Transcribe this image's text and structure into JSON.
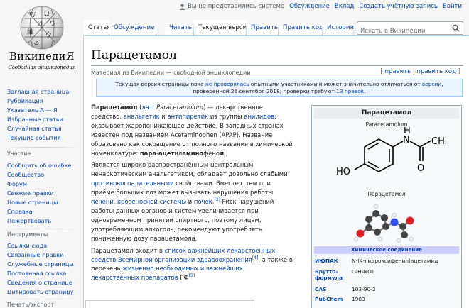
{
  "logo": {
    "name": "ВикипедиЯ",
    "tagline": "Свободная энциклопедия"
  },
  "personal": {
    "not_logged": "Вы не представились системе",
    "links": [
      "Обсуждение",
      "Вклад",
      "Создать учётную запись",
      "Войти"
    ]
  },
  "tabs": {
    "left": [
      {
        "label": "Статья",
        "selected": true
      },
      {
        "label": "Обсуждение",
        "selected": false
      }
    ],
    "right": [
      {
        "label": "Читать",
        "selected": false
      },
      {
        "label": "Текущая версия",
        "selected": true
      },
      {
        "label": "Править",
        "selected": false
      },
      {
        "label": "Править код",
        "selected": false
      },
      {
        "label": "История",
        "selected": false
      }
    ]
  },
  "search": {
    "placeholder": "Искать в Википедии"
  },
  "sidebar": {
    "nav": [
      "Заглавная страница",
      "Рубрикация",
      "Указатель А — Я",
      "Избранные статьи",
      "Случайная статья",
      "Текущие события"
    ],
    "participation_head": "Участие",
    "participation": [
      "Сообщить об ошибке",
      "Сообщество",
      "Форум",
      "Свежие правки",
      "Новые страницы",
      "Справка",
      "Пожертвовать"
    ],
    "tools_head": "Инструменты",
    "tools": [
      "Ссылки сюда",
      "Связанные правки",
      "Служебные страницы",
      "Постоянная ссылка",
      "Сведения о странице",
      "Цитировать страницу"
    ],
    "print_head": "Печать/экспорт"
  },
  "article": {
    "title": "Парацетамол",
    "from": "Материал из Википедии — свободной энциклопедии",
    "edit_open": "[",
    "edit": "править",
    "edit_sep": "|",
    "edit_code": "править код",
    "edit_close": "]",
    "notice": {
      "t1": "Текущая версия страницы пока ",
      "link1": "не проверялась",
      "t2": " опытными участниками и может значительно отличаться от ",
      "link2": "версии",
      "t3": ", проверенной 26 сентября 2018; проверки требуют ",
      "link3": "13 правок",
      "t4": "."
    },
    "p1": {
      "b1": "Парацетамо́л",
      "t1": " (",
      "l_lat": "лат.",
      "i_lat": " Paracetamolum",
      "t2": ") — лекарственное средство, ",
      "l1": "анальгетик",
      "t3": " и ",
      "l2": "антипиретик",
      "t4": " из группы ",
      "l3": "анилидов",
      "t5": ", оказывает жаропонижающее действие. В западных странах известен под названием Acetaminophen (APAP). Название образовано как сокращение от полного названия в химической номенклатуре: ",
      "b2": "пара",
      "t6": "-",
      "b3": "ацет",
      "t7": "ил",
      "b4": "амино",
      "t8": "фено",
      "b5": "л",
      "t9": "."
    },
    "p2": {
      "t1": "Является широко распространённым центральным ненаркотическим анальгетиком, обладает довольно слабыми ",
      "l1": "противовоспалительными",
      "t2": " свойствами. Вместе с тем при приёме больших доз может вызывать нарушения работы ",
      "l2": "печени",
      "t3": ", ",
      "l3": "кровеносной системы",
      "t4": " и ",
      "l4": "почек",
      "t5": ".",
      "ref": "[3]",
      "t6": " Риск нарушений работы данных органов и систем увеличивается при одновременном принятии спиртного, поэтому лицам, употребляющим алкоголь, рекомендуют употреблять пониженную дозу парацетамола."
    },
    "p3": {
      "t1": "Парацетамол входит в ",
      "l1": "список важнейших лекарственных средств Всемирной организации здравоохранения",
      "ref1": "[4]",
      "t2": ", а также в перечень ",
      "l2": "жизненно необходимых и важнейших лекарственных препаратов",
      "t3": " РФ",
      "ref2": "[5]"
    }
  },
  "infobox": {
    "title": "Парацетамол",
    "name_latin": "Paracetamolum",
    "name_ru": "Парацетамол",
    "structure_labels": {
      "nh": "N",
      "h": "H",
      "ho": "HO",
      "o": "O",
      "ch3": "CH₃"
    },
    "section": "Химическое соединение",
    "rows": [
      {
        "label": "ИЮПАК",
        "value": "N-(4-гидроксифенил)ацетамид"
      },
      {
        "label": "Брутто-формула",
        "value": "C₈H₉NO₂"
      },
      {
        "label": "CAS",
        "value": "103-90-2"
      },
      {
        "label": "PubChem",
        "value": "1983"
      }
    ]
  }
}
